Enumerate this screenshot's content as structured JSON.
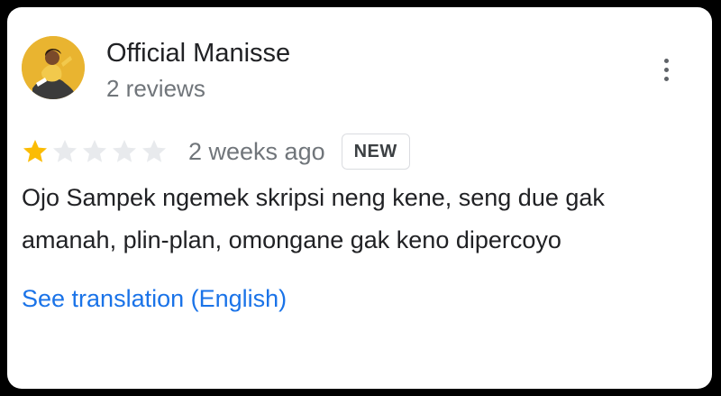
{
  "review": {
    "author_name": "Official Manisse",
    "review_count": "2 reviews",
    "rating": 1,
    "rating_max": 5,
    "time_ago": "2 weeks ago",
    "badge": "NEW",
    "text_lines": [
      "Ojo Sampek ngemek skripsi neng kene, seng due gak",
      "amanah, plin-plan, omongane gak keno dipercoyo"
    ],
    "translate_link": "See translation (English)"
  },
  "icons": {
    "avatar": "profile-photo",
    "more": "more-vert-icon",
    "star_filled": "star-filled-icon",
    "star_empty": "star-empty-icon"
  },
  "colors": {
    "star_filled": "#fbbc04",
    "star_empty": "#e8eaed",
    "link": "#1a73e8",
    "secondary_text": "#70757a"
  }
}
